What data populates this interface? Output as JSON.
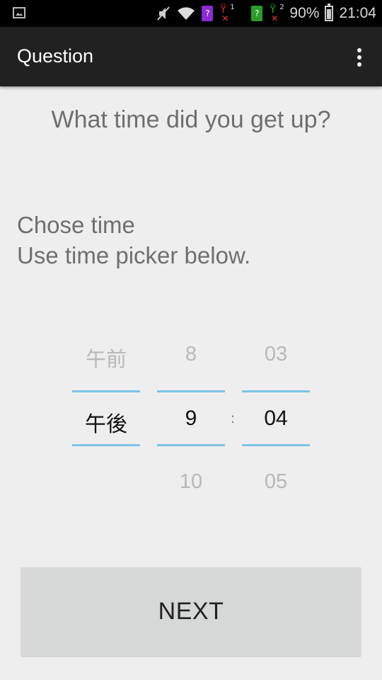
{
  "status_bar": {
    "battery_percent": "90%",
    "time": "21:04",
    "sim1_label": "?",
    "sim2_label": "?",
    "sim1_slot": "1",
    "sim2_slot": "2"
  },
  "action_bar": {
    "title": "Question"
  },
  "question": "What time did you get up?",
  "instructions": {
    "line1": "Chose time",
    "line2": "Use time picker below."
  },
  "time_picker": {
    "ampm": {
      "prev": "午前",
      "current": "午後",
      "next": ""
    },
    "hour": {
      "prev": "8",
      "current": "9",
      "next": "10"
    },
    "separator": ":",
    "minute": {
      "prev": "03",
      "current": "04",
      "next": "05"
    }
  },
  "next_button": "NEXT",
  "colors": {
    "status_bar": "#000000",
    "action_bar": "#212121",
    "background": "#eeeeee",
    "picker_divider": "#7ec3e6",
    "button": "#d6d7d7"
  }
}
